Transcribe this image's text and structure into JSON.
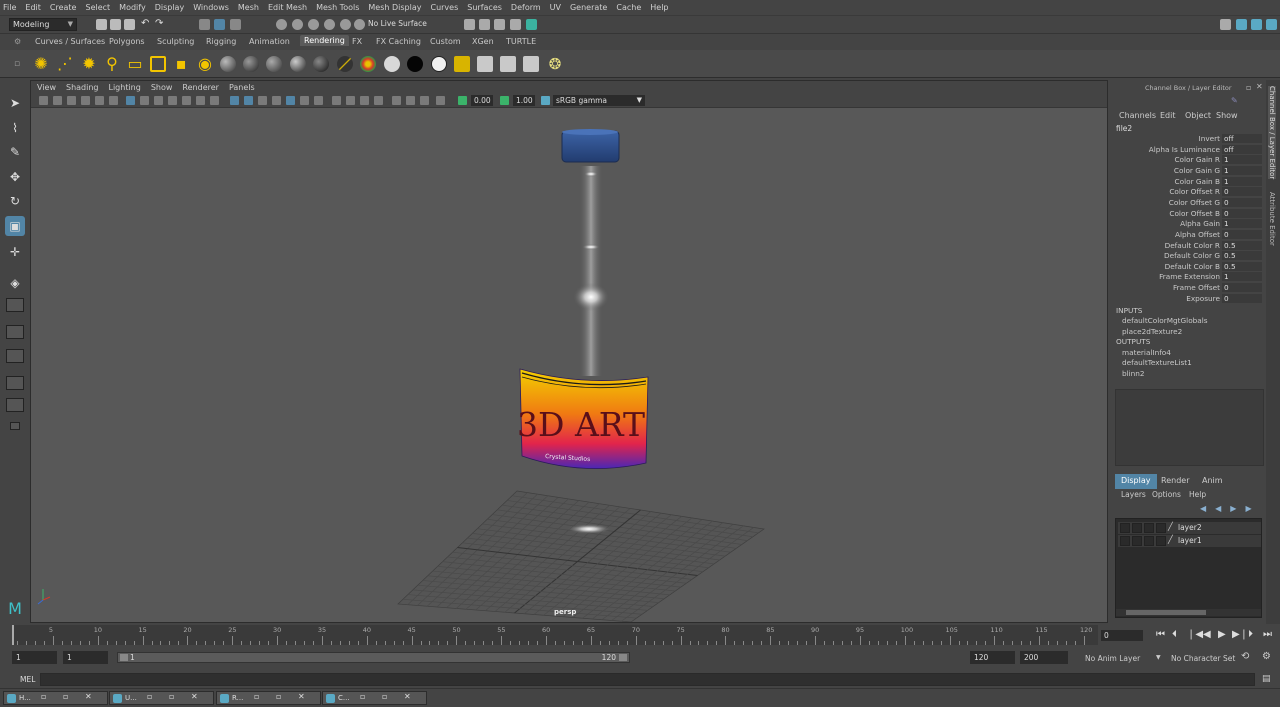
{
  "menubar": [
    "File",
    "Edit",
    "Create",
    "Select",
    "Modify",
    "Display",
    "Windows",
    "Mesh",
    "Edit Mesh",
    "Mesh Tools",
    "Mesh Display",
    "Curves",
    "Surfaces",
    "Deform",
    "UV",
    "Generate",
    "Cache",
    "Help"
  ],
  "status": {
    "mode": "Modeling",
    "live_surface": "No Live Surface"
  },
  "shelf_tabs": [
    "Curves / Surfaces",
    "Polygons",
    "Sculpting",
    "Rigging",
    "Animation",
    "Rendering",
    "FX",
    "FX Caching",
    "Custom",
    "XGen",
    "TURTLE"
  ],
  "shelf_active": "Rendering",
  "viewport": {
    "menu": [
      "View",
      "Shading",
      "Lighting",
      "Show",
      "Renderer",
      "Panels"
    ],
    "exposure": "0.00",
    "gamma": "1.00",
    "color_space": "sRGB gamma",
    "camera_label": "persp",
    "label_main": "3D ART",
    "label_sub": "Crystal Studios"
  },
  "channel_box": {
    "title": "Channel Box / Layer Editor",
    "menu": [
      "Channels",
      "Edit",
      "Object",
      "Show"
    ],
    "node": "file2",
    "attrs": [
      {
        "label": "Invert",
        "value": "off"
      },
      {
        "label": "Alpha Is Luminance",
        "value": "off"
      },
      {
        "label": "Color Gain R",
        "value": "1"
      },
      {
        "label": "Color Gain G",
        "value": "1"
      },
      {
        "label": "Color Gain B",
        "value": "1"
      },
      {
        "label": "Color Offset R",
        "value": "0"
      },
      {
        "label": "Color Offset G",
        "value": "0"
      },
      {
        "label": "Color Offset B",
        "value": "0"
      },
      {
        "label": "Alpha Gain",
        "value": "1"
      },
      {
        "label": "Alpha Offset",
        "value": "0"
      },
      {
        "label": "Default Color R",
        "value": "0.5"
      },
      {
        "label": "Default Color G",
        "value": "0.5"
      },
      {
        "label": "Default Color B",
        "value": "0.5"
      },
      {
        "label": "Frame Extension",
        "value": "1"
      },
      {
        "label": "Frame Offset",
        "value": "0"
      },
      {
        "label": "Exposure",
        "value": "0"
      }
    ],
    "inputs_label": "INPUTS",
    "inputs": [
      "defaultColorMgtGlobals",
      "place2dTexture2"
    ],
    "outputs_label": "OUTPUTS",
    "outputs": [
      "materialInfo4",
      "defaultTextureList1",
      "blinn2"
    ]
  },
  "layer_editor": {
    "tabs": [
      "Display",
      "Render",
      "Anim"
    ],
    "active_tab": "Display",
    "menu": [
      "Layers",
      "Options",
      "Help"
    ],
    "layers": [
      "layer2",
      "layer1"
    ]
  },
  "side_tabs": [
    "Channel Box / Layer Editor",
    "Attribute Editor"
  ],
  "timeline": {
    "ticks": [
      5,
      10,
      15,
      20,
      25,
      30,
      35,
      40,
      45,
      50,
      55,
      60,
      65,
      70,
      75,
      80,
      85,
      90,
      95,
      100,
      105,
      110,
      115,
      120
    ],
    "current_frame": "0"
  },
  "range": {
    "start": "1",
    "start_inner": "1",
    "slider_start": "1",
    "slider_end": "120",
    "end_inner": "120",
    "end": "200",
    "anim_layer": "No Anim Layer",
    "char_set": "No Character Set"
  },
  "command_line": {
    "lang": "MEL"
  },
  "taskbar": [
    {
      "label": "H..."
    },
    {
      "label": "U..."
    },
    {
      "label": "R..."
    },
    {
      "label": "C..."
    }
  ]
}
